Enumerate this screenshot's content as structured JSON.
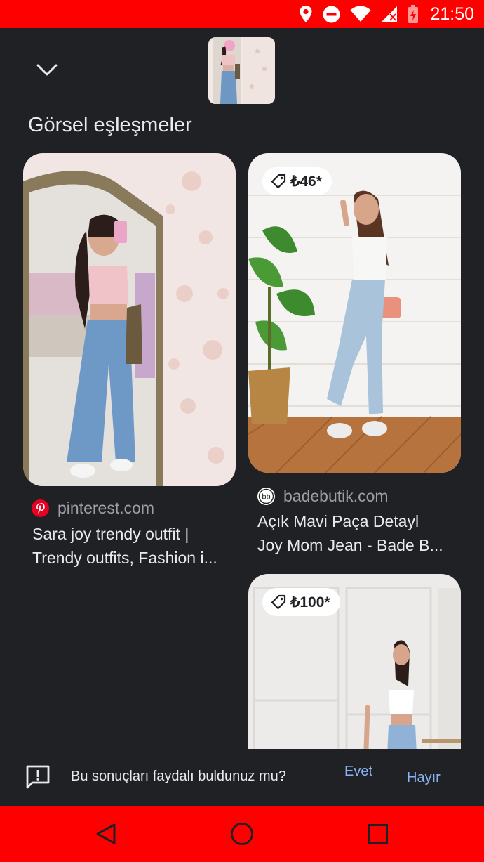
{
  "status_bar": {
    "time": "21:50",
    "icons": [
      "location-icon",
      "do-not-disturb-icon",
      "wifi-icon",
      "signal-icon",
      "battery-icon"
    ],
    "background": "#ff0000"
  },
  "header": {
    "collapse_icon": "chevron-down-icon",
    "query_thumbnail": "query-image-thumbnail"
  },
  "section": {
    "title": "Görsel eşleşmeler"
  },
  "results": [
    {
      "source": "pinterest.com",
      "source_icon": "pinterest-icon",
      "title_line1": "Sara joy trendy outfit |",
      "title_line2": "Trendy outfits, Fashion i...",
      "price": null
    },
    {
      "source": "badebutik.com",
      "source_icon": "badebutik-icon",
      "title_line1": "Açık Mavi Paça Detayl",
      "title_line2": "Joy Mom Jean - Bade B...",
      "price": "₺46*"
    },
    {
      "source": "",
      "title_line1": "",
      "title_line2": "",
      "price": "₺100*"
    }
  ],
  "feedback": {
    "question": "Bu sonuçları faydalı buldunuz mu?",
    "yes_label": "Evet",
    "no_label": "Hayır",
    "icon": "feedback-icon"
  },
  "nav_bar": {
    "buttons": [
      "back-icon",
      "home-icon",
      "recents-icon"
    ],
    "background": "#ff0000"
  },
  "colors": {
    "background": "#202124",
    "text": "#e8eaed",
    "secondary_text": "#9aa0a6",
    "accent": "#8ab4f8"
  }
}
